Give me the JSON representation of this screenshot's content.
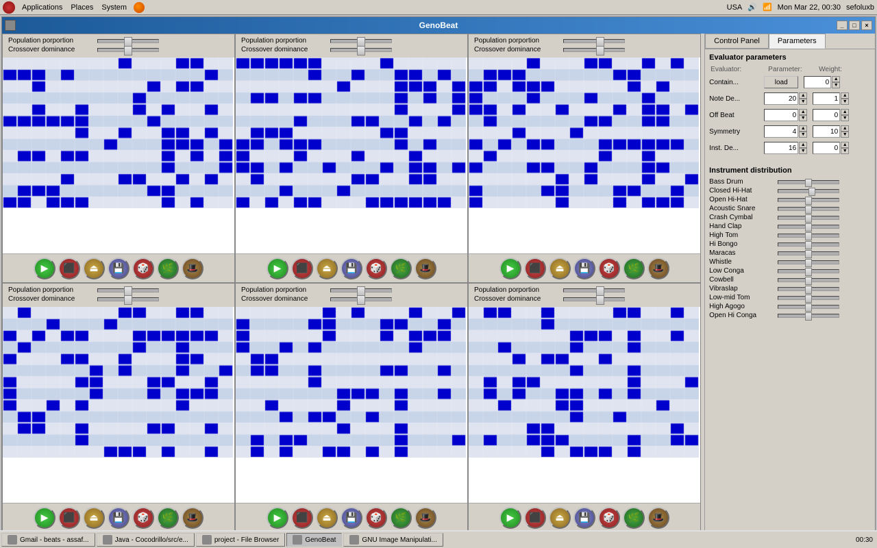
{
  "menubar": {
    "items": [
      "Applications",
      "Places",
      "System"
    ],
    "right": {
      "country": "USA",
      "datetime": "Mon Mar 22, 00:30",
      "user": "sefoluxb"
    }
  },
  "window": {
    "title": "GenoBeat",
    "controls": [
      "_",
      "□",
      "×"
    ]
  },
  "panels": {
    "population_label": "Population porportion",
    "crossover_label": "Crossover dominance"
  },
  "right_panel": {
    "tabs": [
      "Control Panel",
      "Parameters"
    ],
    "active_tab": "Parameters",
    "evaluator_title": "Evaluator parameters",
    "headers": {
      "evaluator": "Evaluator:",
      "parameter": "Parameter:",
      "weight": "Weight:"
    },
    "eval_rows": [
      {
        "name": "Contain...",
        "param_type": "load",
        "param_val": "load",
        "weight": "0"
      },
      {
        "name": "Note De...",
        "param_type": "number",
        "param_val": "20",
        "weight": "1"
      },
      {
        "name": "Off Beat",
        "param_type": "number",
        "param_val": "0",
        "weight": "0"
      },
      {
        "name": "Symmetry",
        "param_type": "number",
        "param_val": "4",
        "weight": "10"
      },
      {
        "name": "Inst. De...",
        "param_type": "number",
        "param_val": "16",
        "weight": "0"
      }
    ],
    "inst_dist_title": "Instrument distribution",
    "instruments": [
      {
        "name": "Bass Drum",
        "position": 50
      },
      {
        "name": "Closed Hi-Hat",
        "position": 55
      },
      {
        "name": "Open Hi-Hat",
        "position": 50
      },
      {
        "name": "Acoustic Snare",
        "position": 50
      },
      {
        "name": "Crash Cymbal",
        "position": 50
      },
      {
        "name": "Hand Clap",
        "position": 50
      },
      {
        "name": "High Tom",
        "position": 50
      },
      {
        "name": "Hi Bongo",
        "position": 50
      },
      {
        "name": "Maracas",
        "position": 50
      },
      {
        "name": "Whistle",
        "position": 50
      },
      {
        "name": "Low Conga",
        "position": 50
      },
      {
        "name": "Cowbell",
        "position": 50
      },
      {
        "name": "Vibraslap",
        "position": 50
      },
      {
        "name": "Low-mid Tom",
        "position": 50
      },
      {
        "name": "High Agogo",
        "position": 50
      },
      {
        "name": "Open Hi Conga",
        "position": 50
      }
    ]
  },
  "taskbar": {
    "items": [
      {
        "label": "Gmail - beats - assaf...",
        "active": false
      },
      {
        "label": "Java - Cocodrillo/src/e...",
        "active": false
      },
      {
        "label": "project - File Browser",
        "active": false
      },
      {
        "label": "GenoBeat",
        "active": true
      },
      {
        "label": "GNU Image Manipulati...",
        "active": false
      }
    ]
  }
}
